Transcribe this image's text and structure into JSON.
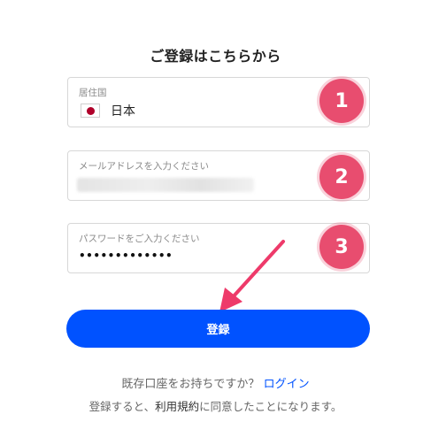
{
  "title": "ご登録はこちらから",
  "country": {
    "label": "居住国",
    "value": "日本"
  },
  "email": {
    "label": "メールアドレスを入力ください"
  },
  "password": {
    "label": "パスワードをご入力ください",
    "masked_value": "•••••••••••••"
  },
  "annotations": {
    "badge1": "1",
    "badge2": "2",
    "badge3": "3",
    "badge_color": "#e84d6f"
  },
  "submit": {
    "label": "登録",
    "color": "#0052ff"
  },
  "footer": {
    "has_account": "既存口座をお持ちですか？",
    "login": "ログイン",
    "agree_prefix": "登録すると、",
    "terms": "利用規約",
    "agree_suffix": "に同意したことになります。"
  },
  "icons": {
    "flag": "japan-flag-icon",
    "chevron": "chevron-down-icon",
    "eye": "eye-icon"
  }
}
